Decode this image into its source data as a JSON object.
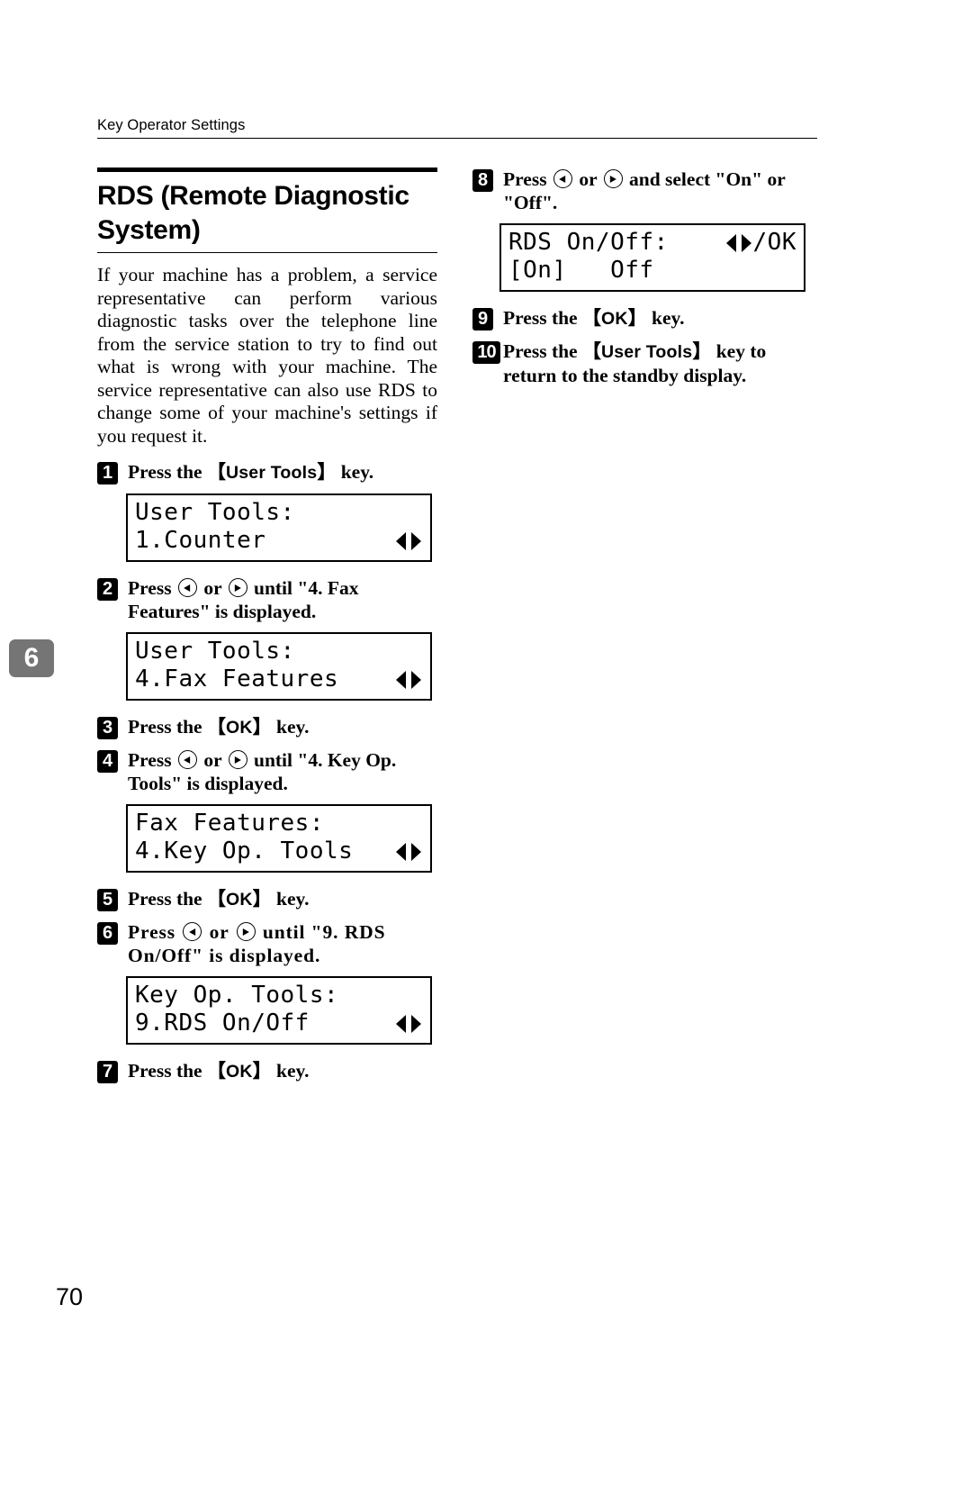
{
  "header": {
    "running_head": "Key Operator Settings"
  },
  "chapter_tab": "6",
  "folio": "70",
  "section": {
    "title": "RDS (Remote Diagnostic System)",
    "intro": "If your machine has a problem, a service representative can perform various diagnostic tasks over the telephone line from the service station to try to find out what is wrong with your machine. The service representative can also use RDS to change some of your machine's settings if you request it."
  },
  "steps": [
    {
      "num": "1",
      "parts": [
        {
          "t": "text",
          "v": "Press the "
        },
        {
          "t": "bracket",
          "v": "【User Tools】"
        },
        {
          "t": "text",
          "v": " key."
        }
      ],
      "key_label": "User Tools"
    },
    {
      "num": "2",
      "key_label": "",
      "pre": "Press ",
      "mid": " or ",
      "post": " until \"4. Fax Features\" is displayed."
    },
    {
      "num": "3",
      "key_label": "OK",
      "pre": "Press the ",
      "post": " key."
    },
    {
      "num": "4",
      "key_label": "",
      "pre": "Press ",
      "mid": " or ",
      "post": " until \"4. Key Op. Tools\" is displayed."
    },
    {
      "num": "5",
      "key_label": "OK",
      "pre": "Press the ",
      "post": " key."
    },
    {
      "num": "6",
      "key_label": "",
      "pre": "Press ",
      "mid": " or ",
      "post": " until \"9. RDS On/Off\" is displayed."
    },
    {
      "num": "7",
      "key_label": "OK",
      "pre": "Press the ",
      "post": " key."
    },
    {
      "num": "8",
      "key_label": "",
      "pre": "Press ",
      "mid": " or ",
      "post": " and select \"On\" or \"Off\"."
    },
    {
      "num": "9",
      "key_label": "OK",
      "pre": "Press the ",
      "post": " key."
    },
    {
      "num": "10",
      "key_label": "User Tools",
      "pre": "Press the ",
      "post": " key to return to the standby display."
    }
  ],
  "lcd_panels": {
    "user_tools_counter": {
      "line1": "User Tools:",
      "line2": "1.Counter",
      "arrows": "left-right-arrows-icon"
    },
    "user_tools_fax": {
      "line1": "User Tools:",
      "line2": "4.Fax Features",
      "arrows": "left-right-arrows-icon"
    },
    "fax_features_keyop": {
      "line1": "Fax Features:",
      "line2": "4.Key Op. Tools",
      "arrows": "left-right-arrows-icon"
    },
    "keyop_rds": {
      "line1": "Key Op. Tools:",
      "line2": "9.RDS On/Off",
      "arrows": "left-right-arrows-icon"
    },
    "rds_onoff": {
      "line1": "RDS On/Off:",
      "line2": "[On]   Off",
      "trailer": "/OK",
      "arrows": "left-right-arrows-icon"
    }
  }
}
